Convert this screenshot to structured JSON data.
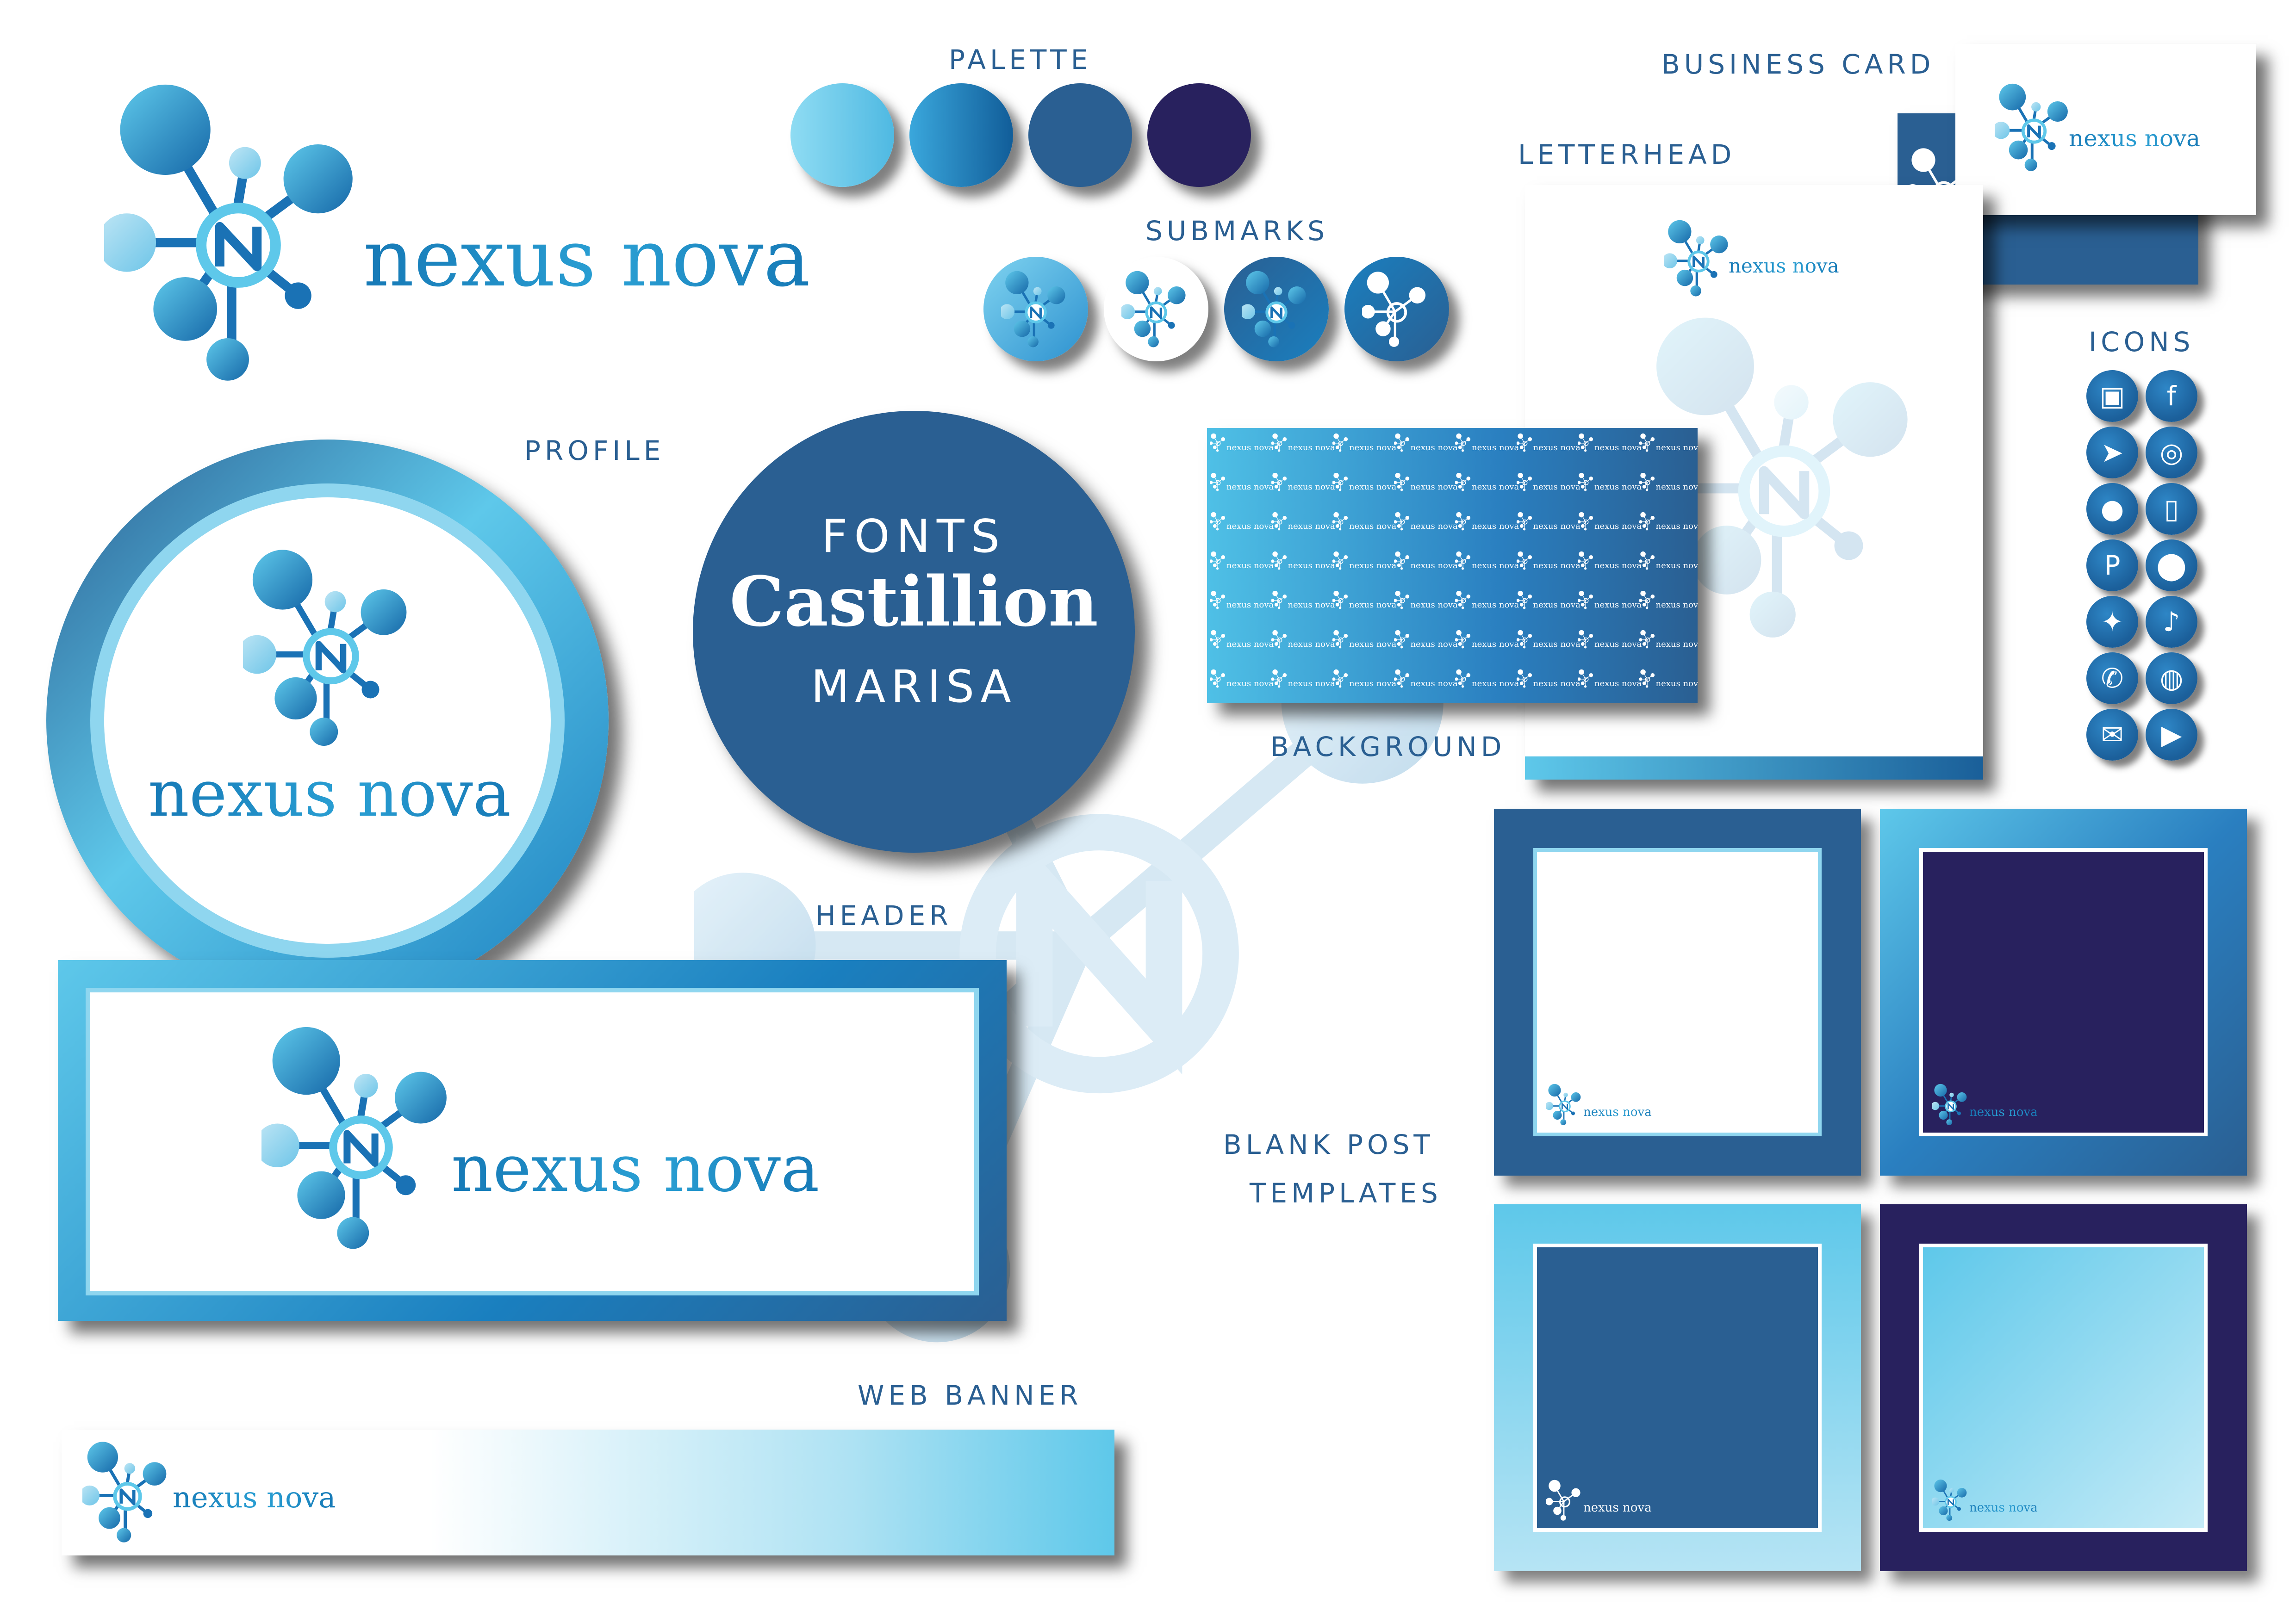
{
  "brand": {
    "name": "nexus nova",
    "colors": {
      "sky": "#5ec8ea",
      "mid": "#1a7fbf",
      "steel": "#2a5f92",
      "navy": "#28215e"
    }
  },
  "labels": {
    "palette": "PALETTE",
    "submarks": "SUBMARKS",
    "business_card": "BUSINESS CARD",
    "letterhead": "LETTERHEAD",
    "icons": "ICONS",
    "profile": "PROFILE",
    "background": "BACKGROUND",
    "header": "HEADER",
    "blank_post_line1": "BLANK POST",
    "blank_post_line2": "TEMPLATES",
    "web_banner": "WEB BANNER"
  },
  "fonts": {
    "heading": "FONTS",
    "primary": "Castillion",
    "secondary": "MARISA"
  },
  "icons": [
    {
      "name": "instagram-tv-icon",
      "glyph": "▣"
    },
    {
      "name": "facebook-icon",
      "glyph": "f"
    },
    {
      "name": "cursor-icon",
      "glyph": "➤"
    },
    {
      "name": "instagram-icon",
      "glyph": "◎"
    },
    {
      "name": "user-icon",
      "glyph": "●"
    },
    {
      "name": "phone-icon",
      "glyph": "▯"
    },
    {
      "name": "pinterest-icon",
      "glyph": "P"
    },
    {
      "name": "location-pin-icon",
      "glyph": "⬤"
    },
    {
      "name": "twitter-icon",
      "glyph": "✦"
    },
    {
      "name": "tiktok-icon",
      "glyph": "♪"
    },
    {
      "name": "whatsapp-icon",
      "glyph": "✆"
    },
    {
      "name": "globe-icon",
      "glyph": "◍"
    },
    {
      "name": "mail-icon",
      "glyph": "✉"
    },
    {
      "name": "youtube-icon",
      "glyph": "▶"
    }
  ]
}
